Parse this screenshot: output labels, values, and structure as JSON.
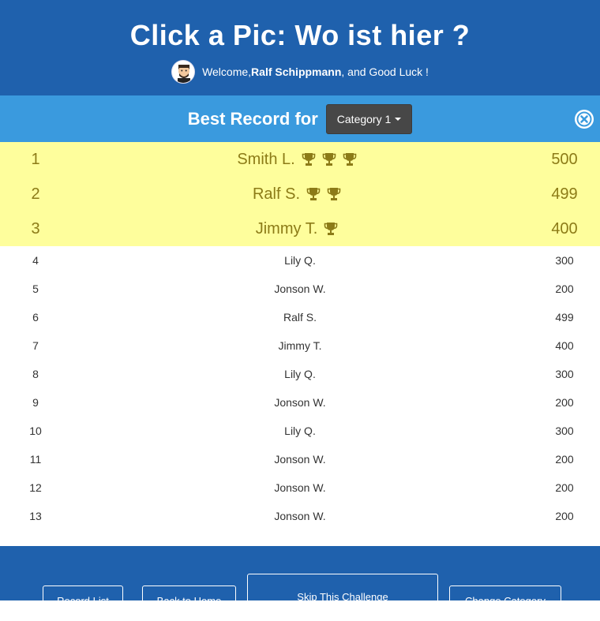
{
  "header": {
    "title": "Click a Pic: Wo ist hier ?",
    "welcome_prefix": "Welcome, ",
    "user_name": "Ralf Schippmann",
    "welcome_suffix": ", and Good Luck !"
  },
  "category_bar": {
    "title": "Best Record for",
    "selected_category": "Category 1"
  },
  "top_records": [
    {
      "rank": "1",
      "name": "Smith L.",
      "trophies": 3,
      "score": "500"
    },
    {
      "rank": "2",
      "name": "Ralf S.",
      "trophies": 2,
      "score": "499"
    },
    {
      "rank": "3",
      "name": "Jimmy T.",
      "trophies": 1,
      "score": "400"
    }
  ],
  "records": [
    {
      "rank": "4",
      "name": "Lily Q.",
      "score": "300"
    },
    {
      "rank": "5",
      "name": "Jonson W.",
      "score": "200"
    },
    {
      "rank": "6",
      "name": "Ralf S.",
      "score": "499"
    },
    {
      "rank": "7",
      "name": "Jimmy T.",
      "score": "400"
    },
    {
      "rank": "8",
      "name": "Lily Q.",
      "score": "300"
    },
    {
      "rank": "9",
      "name": "Jonson W.",
      "score": "200"
    },
    {
      "rank": "10",
      "name": "Lily Q.",
      "score": "300"
    },
    {
      "rank": "11",
      "name": "Jonson W.",
      "score": "200"
    },
    {
      "rank": "12",
      "name": "Jonson W.",
      "score": "200"
    },
    {
      "rank": "13",
      "name": "Jonson W.",
      "score": "200"
    }
  ],
  "footer": {
    "record_list": "Record List",
    "back_to_home": "Back to Home",
    "skip_challenge": "Skip This Challenge",
    "change_category": "Change Category"
  },
  "icons": {
    "trophy": "trophy-icon",
    "close": "close-circle-icon",
    "avatar": "avatar"
  },
  "colors": {
    "header_bg": "#1f61ad",
    "category_bar_bg": "#3a9ade",
    "top3_bg": "#fefe9c",
    "top3_text": "#8c7b17",
    "dropdown_bg": "#474747"
  }
}
